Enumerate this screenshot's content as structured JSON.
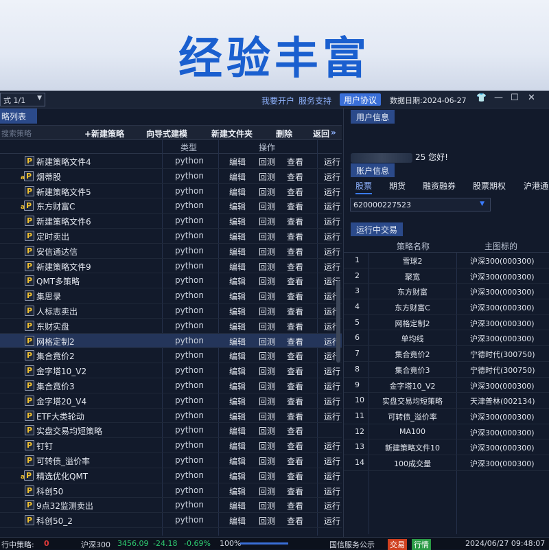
{
  "banner": {
    "title": "经验丰富"
  },
  "topbar": {
    "mode": "式 1/1",
    "links": [
      "我要开户",
      "服务支持"
    ],
    "agreement": "用户协议",
    "data_date": "数据日期:2024-06-27",
    "win": {
      "shirt": "👕",
      "min": "—",
      "max": "☐",
      "close": "✕"
    }
  },
  "strategy_panel": {
    "title": "略列表",
    "search_placeholder": "搜索策略",
    "toolbar": [
      "+新建策略",
      "向导式建模",
      "新建文件夹",
      "删除",
      "返回"
    ],
    "more": "»",
    "columns": {
      "type": "类型",
      "ops": "操作"
    },
    "ops": [
      "编辑",
      "回测",
      "查看",
      "运行"
    ],
    "rows": [
      {
        "name": "新建策略文件4",
        "type": "python",
        "ap": false,
        "run": true
      },
      {
        "name": "烟蒂股",
        "type": "python",
        "ap": true,
        "run": true
      },
      {
        "name": "新建策略文件5",
        "type": "python",
        "ap": false,
        "run": true
      },
      {
        "name": "东方财富C",
        "type": "python",
        "ap": true,
        "run": true
      },
      {
        "name": "新建策略文件6",
        "type": "python",
        "ap": false,
        "run": true
      },
      {
        "name": "定时卖出",
        "type": "python",
        "ap": false,
        "run": true
      },
      {
        "name": "安信通达信",
        "type": "python",
        "ap": false,
        "run": true
      },
      {
        "name": "新建策略文件9",
        "type": "python",
        "ap": false,
        "run": true
      },
      {
        "name": "QMT多策略",
        "type": "python",
        "ap": false,
        "run": true
      },
      {
        "name": "集思录",
        "type": "python",
        "ap": false,
        "run": true
      },
      {
        "name": "人标志卖出",
        "type": "python",
        "ap": false,
        "run": true
      },
      {
        "name": "东财实盘",
        "type": "python",
        "ap": false,
        "run": true
      },
      {
        "name": "网格定制2",
        "type": "python",
        "ap": false,
        "run": true,
        "selected": true
      },
      {
        "name": "集合竟价2",
        "type": "python",
        "ap": false,
        "run": true
      },
      {
        "name": "金字塔10_V2",
        "type": "python",
        "ap": false,
        "run": true
      },
      {
        "name": "集合竟价3",
        "type": "python",
        "ap": false,
        "run": true
      },
      {
        "name": "金字塔20_V4",
        "type": "python",
        "ap": false,
        "run": true
      },
      {
        "name": "ETF大类轮动",
        "type": "python",
        "ap": false,
        "run": true
      },
      {
        "name": "实盘交易均短策略",
        "type": "python",
        "ap": false,
        "run": false
      },
      {
        "name": "钉钉",
        "type": "python",
        "ap": false,
        "run": true
      },
      {
        "name": "可转债_溢价率",
        "type": "python",
        "ap": false,
        "run": true
      },
      {
        "name": "精选优化QMT",
        "type": "python",
        "ap": true,
        "run": true
      },
      {
        "name": "科创50",
        "type": "python",
        "ap": false,
        "run": true
      },
      {
        "name": "9点32监测卖出",
        "type": "python",
        "ap": false,
        "run": true
      },
      {
        "name": "科创50_2",
        "type": "python",
        "ap": false,
        "run": true
      }
    ]
  },
  "user_panel": {
    "title": "用户信息",
    "greeting_suffix": "25 您好!",
    "account_title": "账户信息",
    "account_tabs": [
      "股票",
      "期货",
      "融资融券",
      "股票期权",
      "沪港通"
    ],
    "account_no": "620000227523",
    "trade_title": "运行中交易",
    "trade_columns": {
      "name": "策略名称",
      "target": "主图标的"
    },
    "trades": [
      {
        "no": "1",
        "name": "雪球2",
        "target": "沪深300(000300)"
      },
      {
        "no": "2",
        "name": "聚宽",
        "target": "沪深300(000300)"
      },
      {
        "no": "3",
        "name": "东方财富",
        "target": "沪深300(000300)"
      },
      {
        "no": "4",
        "name": "东方财富C",
        "target": "沪深300(000300)"
      },
      {
        "no": "5",
        "name": "网格定制2",
        "target": "沪深300(000300)"
      },
      {
        "no": "6",
        "name": "单均线",
        "target": "沪深300(000300)"
      },
      {
        "no": "7",
        "name": "集合竟价2",
        "target": "宁德时代(300750)"
      },
      {
        "no": "8",
        "name": "集合竟价3",
        "target": "宁德时代(300750)"
      },
      {
        "no": "9",
        "name": "金字塔10_V2",
        "target": "沪深300(000300)"
      },
      {
        "no": "10",
        "name": "实盘交易均短策略",
        "target": "天津普林(002134)"
      },
      {
        "no": "11",
        "name": "可转债_溢价率",
        "target": "沪深300(000300)"
      },
      {
        "no": "12",
        "name": "MA100",
        "target": "沪深300(000300)"
      },
      {
        "no": "13",
        "name": "新建策略文件10",
        "target": "沪深300(000300)"
      },
      {
        "no": "14",
        "name": "100成交量",
        "target": "沪深300(000300)"
      }
    ]
  },
  "statusbar": {
    "running_label": "行中策略:",
    "running_count": "0",
    "index_name": "沪深300",
    "index_val": "3456.09",
    "index_chg": "-24.18",
    "index_pct": "-0.69%",
    "zoom": "100%",
    "service": "国信服务公示",
    "trade": "交易",
    "quote": "行情",
    "datetime": "2024/06/27 09:48:07"
  },
  "colors": {
    "accent": "#3a6fd8",
    "banner_text": "#1a5fcf",
    "up": "#2ecc71",
    "down": "#e03a3a"
  }
}
